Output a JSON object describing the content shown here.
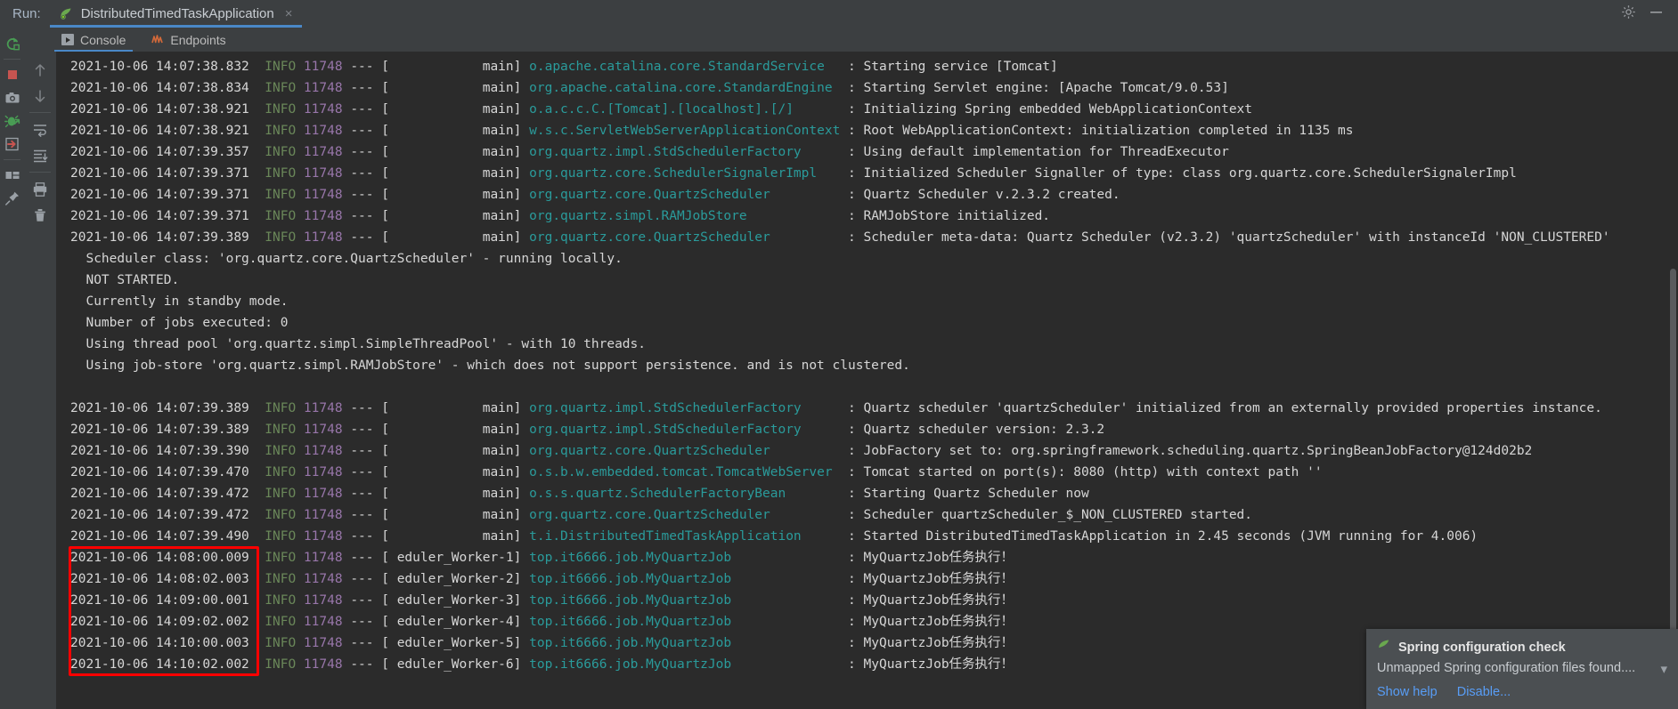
{
  "window": {
    "run_label": "Run:",
    "run_tab_title": "DistributedTimedTaskApplication",
    "tab_close": "×",
    "settings_icon": "gear-icon",
    "minimize_icon": "minimize-icon"
  },
  "tabs": [
    {
      "label": "Console",
      "icon": "console-icon",
      "active": true
    },
    {
      "label": "Endpoints",
      "icon": "endpoints-icon",
      "active": false
    }
  ],
  "left_rail": [
    {
      "name": "rerun-icon"
    },
    {
      "name": "stop-icon"
    },
    {
      "name": "camera-icon"
    },
    {
      "name": "debug-icon"
    },
    {
      "name": "exit-icon"
    },
    {
      "name": "layout-icon"
    },
    {
      "name": "pin-icon"
    }
  ],
  "inner_rail": [
    {
      "name": "up-arrow-icon"
    },
    {
      "name": "down-arrow-icon"
    },
    {
      "name": "soft-wrap-icon"
    },
    {
      "name": "scroll-to-end-icon"
    },
    {
      "name": "print-icon"
    },
    {
      "name": "trash-icon"
    }
  ],
  "console": {
    "lines": [
      {
        "type": "log",
        "ts": "2021-10-06 14:07:38.832",
        "lvl": "INFO",
        "pid": "11748",
        "thread": "main",
        "logger": "o.apache.catalina.core.StandardService",
        "msg": "Starting service [Tomcat]"
      },
      {
        "type": "log",
        "ts": "2021-10-06 14:07:38.834",
        "lvl": "INFO",
        "pid": "11748",
        "thread": "main",
        "logger": "org.apache.catalina.core.StandardEngine",
        "msg": "Starting Servlet engine: [Apache Tomcat/9.0.53]"
      },
      {
        "type": "log",
        "ts": "2021-10-06 14:07:38.921",
        "lvl": "INFO",
        "pid": "11748",
        "thread": "main",
        "logger": "o.a.c.c.C.[Tomcat].[localhost].[/]",
        "msg": "Initializing Spring embedded WebApplicationContext"
      },
      {
        "type": "log",
        "ts": "2021-10-06 14:07:38.921",
        "lvl": "INFO",
        "pid": "11748",
        "thread": "main",
        "logger": "w.s.c.ServletWebServerApplicationContext",
        "msg": "Root WebApplicationContext: initialization completed in 1135 ms"
      },
      {
        "type": "log",
        "ts": "2021-10-06 14:07:39.357",
        "lvl": "INFO",
        "pid": "11748",
        "thread": "main",
        "logger": "org.quartz.impl.StdSchedulerFactory",
        "msg": "Using default implementation for ThreadExecutor"
      },
      {
        "type": "log",
        "ts": "2021-10-06 14:07:39.371",
        "lvl": "INFO",
        "pid": "11748",
        "thread": "main",
        "logger": "org.quartz.core.SchedulerSignalerImpl",
        "msg": "Initialized Scheduler Signaller of type: class org.quartz.core.SchedulerSignalerImpl"
      },
      {
        "type": "log",
        "ts": "2021-10-06 14:07:39.371",
        "lvl": "INFO",
        "pid": "11748",
        "thread": "main",
        "logger": "org.quartz.core.QuartzScheduler",
        "msg": "Quartz Scheduler v.2.3.2 created."
      },
      {
        "type": "log",
        "ts": "2021-10-06 14:07:39.371",
        "lvl": "INFO",
        "pid": "11748",
        "thread": "main",
        "logger": "org.quartz.simpl.RAMJobStore",
        "msg": "RAMJobStore initialized."
      },
      {
        "type": "log",
        "ts": "2021-10-06 14:07:39.389",
        "lvl": "INFO",
        "pid": "11748",
        "thread": "main",
        "logger": "org.quartz.core.QuartzScheduler",
        "msg": "Scheduler meta-data: Quartz Scheduler (v2.3.2) 'quartzScheduler' with instanceId 'NON_CLUSTERED'"
      },
      {
        "type": "plain",
        "text": "  Scheduler class: 'org.quartz.core.QuartzScheduler' - running locally."
      },
      {
        "type": "plain",
        "text": "  NOT STARTED."
      },
      {
        "type": "plain",
        "text": "  Currently in standby mode."
      },
      {
        "type": "plain",
        "text": "  Number of jobs executed: 0"
      },
      {
        "type": "plain",
        "text": "  Using thread pool 'org.quartz.simpl.SimpleThreadPool' - with 10 threads."
      },
      {
        "type": "plain",
        "text": "  Using job-store 'org.quartz.simpl.RAMJobStore' - which does not support persistence. and is not clustered."
      },
      {
        "type": "blank",
        "text": ""
      },
      {
        "type": "log",
        "ts": "2021-10-06 14:07:39.389",
        "lvl": "INFO",
        "pid": "11748",
        "thread": "main",
        "logger": "org.quartz.impl.StdSchedulerFactory",
        "msg": "Quartz scheduler 'quartzScheduler' initialized from an externally provided properties instance."
      },
      {
        "type": "log",
        "ts": "2021-10-06 14:07:39.389",
        "lvl": "INFO",
        "pid": "11748",
        "thread": "main",
        "logger": "org.quartz.impl.StdSchedulerFactory",
        "msg": "Quartz scheduler version: 2.3.2"
      },
      {
        "type": "log",
        "ts": "2021-10-06 14:07:39.390",
        "lvl": "INFO",
        "pid": "11748",
        "thread": "main",
        "logger": "org.quartz.core.QuartzScheduler",
        "msg": "JobFactory set to: org.springframework.scheduling.quartz.SpringBeanJobFactory@124d02b2"
      },
      {
        "type": "log",
        "ts": "2021-10-06 14:07:39.470",
        "lvl": "INFO",
        "pid": "11748",
        "thread": "main",
        "logger": "o.s.b.w.embedded.tomcat.TomcatWebServer",
        "msg": "Tomcat started on port(s): 8080 (http) with context path ''"
      },
      {
        "type": "log",
        "ts": "2021-10-06 14:07:39.472",
        "lvl": "INFO",
        "pid": "11748",
        "thread": "main",
        "logger": "o.s.s.quartz.SchedulerFactoryBean",
        "msg": "Starting Quartz Scheduler now"
      },
      {
        "type": "log",
        "ts": "2021-10-06 14:07:39.472",
        "lvl": "INFO",
        "pid": "11748",
        "thread": "main",
        "logger": "org.quartz.core.QuartzScheduler",
        "msg": "Scheduler quartzScheduler_$_NON_CLUSTERED started."
      },
      {
        "type": "log",
        "ts": "2021-10-06 14:07:39.490",
        "lvl": "INFO",
        "pid": "11748",
        "thread": "main",
        "logger": "t.i.DistributedTimedTaskApplication",
        "msg": "Started DistributedTimedTaskApplication in 2.45 seconds (JVM running for 4.006)"
      },
      {
        "type": "log",
        "ts": "2021-10-06 14:08:00.009",
        "lvl": "INFO",
        "pid": "11748",
        "thread": "eduler_Worker-1",
        "logger": "top.it6666.job.MyQuartzJob",
        "msg": "MyQuartzJob任务执行！",
        "highlight": true
      },
      {
        "type": "log",
        "ts": "2021-10-06 14:08:02.003",
        "lvl": "INFO",
        "pid": "11748",
        "thread": "eduler_Worker-2",
        "logger": "top.it6666.job.MyQuartzJob",
        "msg": "MyQuartzJob任务执行！",
        "highlight": true
      },
      {
        "type": "log",
        "ts": "2021-10-06 14:09:00.001",
        "lvl": "INFO",
        "pid": "11748",
        "thread": "eduler_Worker-3",
        "logger": "top.it6666.job.MyQuartzJob",
        "msg": "MyQuartzJob任务执行！",
        "highlight": true
      },
      {
        "type": "log",
        "ts": "2021-10-06 14:09:02.002",
        "lvl": "INFO",
        "pid": "11748",
        "thread": "eduler_Worker-4",
        "logger": "top.it6666.job.MyQuartzJob",
        "msg": "MyQuartzJob任务执行！",
        "highlight": true
      },
      {
        "type": "log",
        "ts": "2021-10-06 14:10:00.003",
        "lvl": "INFO",
        "pid": "11748",
        "thread": "eduler_Worker-5",
        "logger": "top.it6666.job.MyQuartzJob",
        "msg": "MyQuartzJob任务执行！",
        "highlight": true
      },
      {
        "type": "log",
        "ts": "2021-10-06 14:10:02.002",
        "lvl": "INFO",
        "pid": "11748",
        "thread": "eduler_Worker-6",
        "logger": "top.it6666.job.MyQuartzJob",
        "msg": "MyQuartzJob任务执行！",
        "highlight": true
      }
    ]
  },
  "notification": {
    "icon": "spring-leaf-icon",
    "title": "Spring configuration check",
    "body": "Unmapped Spring configuration files found....",
    "collapse_icon": "chevron-down-icon",
    "links": [
      {
        "label": "Show help"
      },
      {
        "label": "Disable..."
      }
    ]
  },
  "colors": {
    "accent": "#4a88c7",
    "console_bg": "#2b2b2b",
    "panel_bg": "#3c3f41",
    "logger": "#2a9b9b",
    "level": "#6a8759",
    "pid": "#9876aa",
    "highlight_box": "#ff0000",
    "link": "#589df6"
  }
}
